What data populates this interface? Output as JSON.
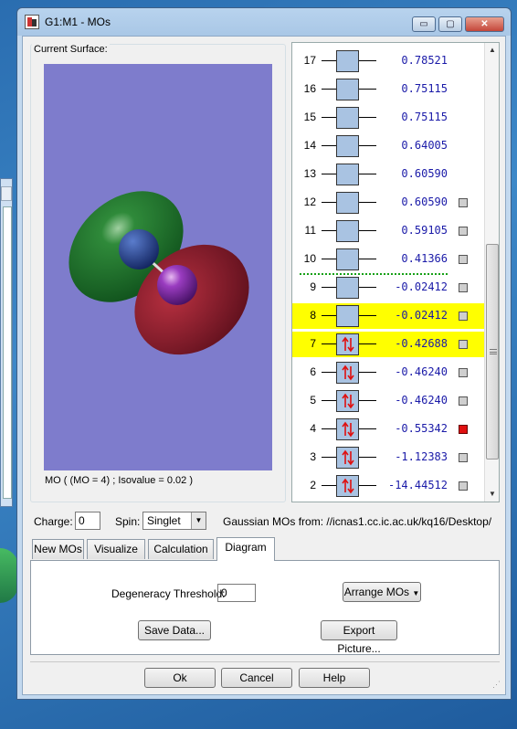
{
  "window": {
    "title": "G1:M1 - MOs"
  },
  "window_controls": {
    "minimize": "▭",
    "maximize": "▢",
    "close": "✕"
  },
  "surface": {
    "label": "Current Surface:",
    "caption": "MO ( (MO = 4) ; Isovalue = 0.02 )"
  },
  "orbitals": [
    {
      "index": "17",
      "energy": "0.78521",
      "occupied": false,
      "highlighted": false,
      "checkbox": false
    },
    {
      "index": "16",
      "energy": "0.75115",
      "occupied": false,
      "highlighted": false,
      "checkbox": false
    },
    {
      "index": "15",
      "energy": "0.75115",
      "occupied": false,
      "highlighted": false,
      "checkbox": false
    },
    {
      "index": "14",
      "energy": "0.64005",
      "occupied": false,
      "highlighted": false,
      "checkbox": false
    },
    {
      "index": "13",
      "energy": "0.60590",
      "occupied": false,
      "highlighted": false,
      "checkbox": false
    },
    {
      "index": "12",
      "energy": "0.60590",
      "occupied": false,
      "highlighted": false,
      "checkbox": true
    },
    {
      "index": "11",
      "energy": "0.59105",
      "occupied": false,
      "highlighted": false,
      "checkbox": true
    },
    {
      "index": "10",
      "energy": "0.41366",
      "occupied": false,
      "highlighted": false,
      "checkbox": true
    },
    {
      "index": "9",
      "energy": "-0.02412",
      "occupied": false,
      "highlighted": false,
      "checkbox": true
    },
    {
      "index": "8",
      "energy": "-0.02412",
      "occupied": false,
      "highlighted": true,
      "checkbox": true
    },
    {
      "index": "7",
      "energy": "-0.42688",
      "occupied": true,
      "highlighted": true,
      "checkbox": true
    },
    {
      "index": "6",
      "energy": "-0.46240",
      "occupied": true,
      "highlighted": false,
      "checkbox": true
    },
    {
      "index": "5",
      "energy": "-0.46240",
      "occupied": true,
      "highlighted": false,
      "checkbox": true
    },
    {
      "index": "4",
      "energy": "-0.55342",
      "occupied": true,
      "highlighted": false,
      "checkbox": true,
      "selected": true
    },
    {
      "index": "3",
      "energy": "-1.12383",
      "occupied": true,
      "highlighted": false,
      "checkbox": true
    },
    {
      "index": "2",
      "energy": "-14.44512",
      "occupied": true,
      "highlighted": false,
      "checkbox": true
    }
  ],
  "colors": {
    "highlight": "#ffff00",
    "energy_text": "#1a1aa8",
    "homo_lumo_separator": "#17a017",
    "selected_checkbox": "#e01010",
    "viewport_bg": "#7e7ccc",
    "lobe_positive": "#1f7a2e",
    "lobe_negative": "#8a1a2a"
  },
  "charge": {
    "label": "Charge:",
    "value": "0"
  },
  "spin": {
    "label": "Spin:",
    "value": "Singlet"
  },
  "gaussian": {
    "label": "Gaussian MOs from:  //icnas1.cc.ic.ac.uk/kq16/Desktop/"
  },
  "tabs": [
    {
      "label": "New MOs"
    },
    {
      "label": "Visualize"
    },
    {
      "label": "Calculation"
    },
    {
      "label": "Diagram",
      "active": true
    }
  ],
  "diagram_tab": {
    "degeneracy_label": "Degeneracy Threshold:",
    "degeneracy_value": "0",
    "arrange_button": "Arrange MOs",
    "save_button": "Save Data...",
    "export_button": "Export Picture..."
  },
  "footer": {
    "ok": "Ok",
    "cancel": "Cancel",
    "help": "Help"
  }
}
